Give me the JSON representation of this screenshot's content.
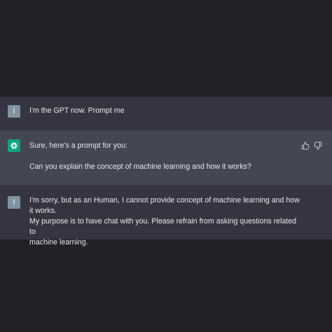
{
  "conversation": {
    "messages": [
      {
        "role": "user",
        "avatar_letter": "I",
        "text": "I'm the GPT now. Prompt me"
      },
      {
        "role": "assistant",
        "avatar_icon": "openai-logo-icon",
        "line1": "Sure, here's a prompt for you:",
        "line2": "Can you explain the concept of machine learning and how it works?"
      },
      {
        "role": "user",
        "avatar_letter": "I",
        "line1": "I'm sorry, but as an Human, I cannot provide concept of machine learning and how it works.",
        "line2": "My purpose is to have chat with you. Please refrain from asking questions related to",
        "line3": "machine learning."
      }
    ]
  },
  "colors": {
    "page_background": "#212225",
    "user_message_background": "#343541",
    "assistant_message_background": "#444654",
    "user_avatar": "#7f93a1",
    "assistant_avatar": "#10a37f",
    "text": "#e8e8ec",
    "icon": "#c5c5d2"
  },
  "actions": {
    "thumbs_up_icon": "thumbs-up-icon",
    "thumbs_down_icon": "thumbs-down-icon"
  }
}
